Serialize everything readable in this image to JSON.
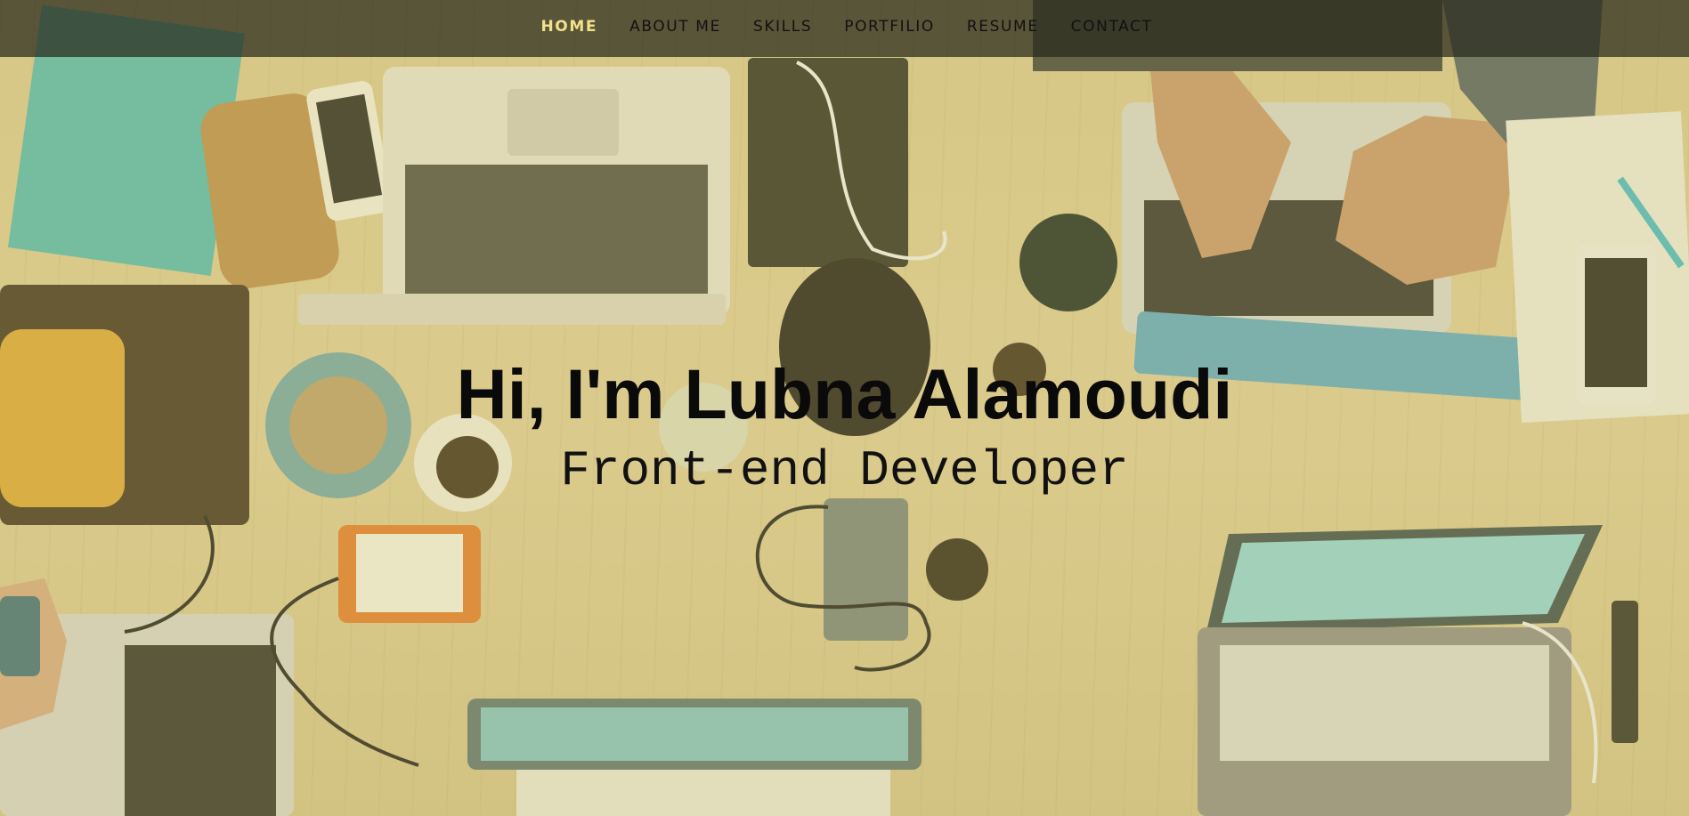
{
  "nav": {
    "items": [
      {
        "label": "HOME",
        "active": true
      },
      {
        "label": "ABOUT ME",
        "active": false
      },
      {
        "label": "SKILLS",
        "active": false
      },
      {
        "label": "PORTFILIO",
        "active": false
      },
      {
        "label": "RESUME",
        "active": false
      },
      {
        "label": "CONTACT",
        "active": false
      }
    ],
    "active_color": "#f2e08a"
  },
  "hero": {
    "name": "Hi, I'm Lubna Alamoudi",
    "role": "Front-end Developer"
  },
  "background": {
    "description_icon": "desk-with-laptops-photo",
    "overlay_color": "#d7cd6e"
  }
}
